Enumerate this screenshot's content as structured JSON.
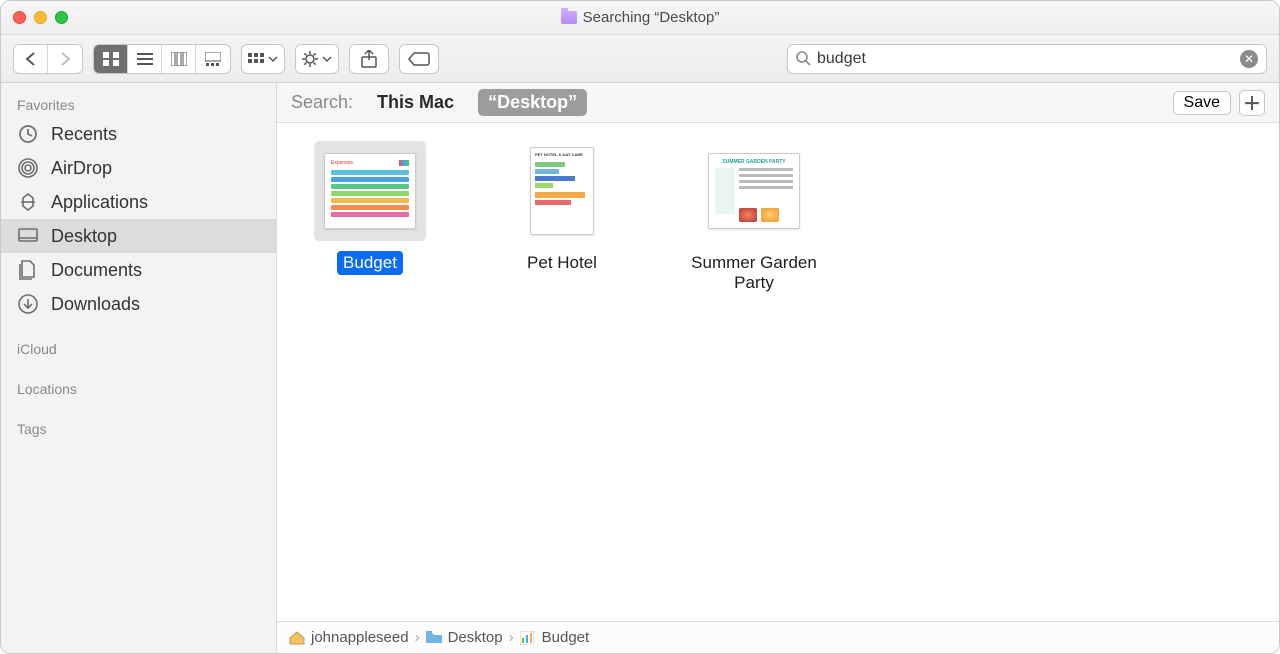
{
  "window": {
    "title": "Searching “Desktop”"
  },
  "toolbar": {
    "search_value": "budget"
  },
  "sidebar": {
    "sections": [
      {
        "heading": "Favorites",
        "items": [
          {
            "label": "Recents",
            "icon": "clock"
          },
          {
            "label": "AirDrop",
            "icon": "airdrop"
          },
          {
            "label": "Applications",
            "icon": "apps"
          },
          {
            "label": "Desktop",
            "icon": "desktop",
            "selected": true
          },
          {
            "label": "Documents",
            "icon": "documents"
          },
          {
            "label": "Downloads",
            "icon": "downloads"
          }
        ]
      },
      {
        "heading": "iCloud",
        "items": []
      },
      {
        "heading": "Locations",
        "items": []
      },
      {
        "heading": "Tags",
        "items": []
      }
    ]
  },
  "scope": {
    "label": "Search:",
    "this_mac": "This Mac",
    "scoped": "“Desktop”",
    "active": "scoped",
    "save": "Save"
  },
  "results": [
    {
      "name": "Budget",
      "selected": true,
      "thumb": "spreadsheet"
    },
    {
      "name": "Pet Hotel",
      "thumb": "pethotel"
    },
    {
      "name": "Summer Garden Party",
      "thumb": "garden"
    }
  ],
  "path": {
    "crumbs": [
      {
        "label": "johnappleseed",
        "icon": "home"
      },
      {
        "label": "Desktop",
        "icon": "folder"
      },
      {
        "label": "Budget",
        "icon": "numbers"
      }
    ]
  }
}
